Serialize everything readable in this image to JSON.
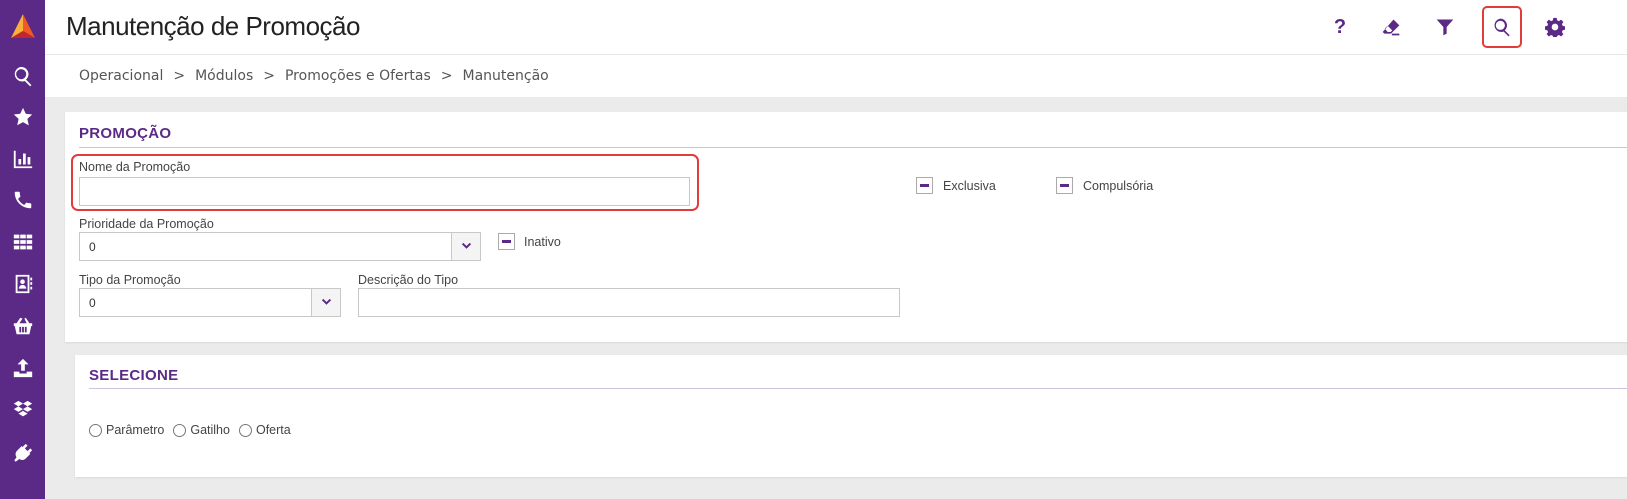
{
  "header": {
    "title": "Manutenção de Promoção",
    "buttons": {
      "help": "?",
      "eraser": "eraser-icon",
      "filter": "filter-icon",
      "search": "search-icon",
      "settings": "gear-icon"
    }
  },
  "sidebar": {
    "items": [
      {
        "icon": "logo-icon"
      },
      {
        "icon": "search-icon"
      },
      {
        "icon": "star-icon"
      },
      {
        "icon": "bar-chart-icon"
      },
      {
        "icon": "phone-icon"
      },
      {
        "icon": "grid-icon"
      },
      {
        "icon": "contact-book-icon"
      },
      {
        "icon": "basket-icon"
      },
      {
        "icon": "upload-icon"
      },
      {
        "icon": "boxes-icon"
      },
      {
        "icon": "plug-icon"
      }
    ]
  },
  "breadcrumb": [
    "Operacional",
    "Módulos",
    "Promoções e Ofertas",
    "Manutenção"
  ],
  "breadcrumb_sep": ">",
  "promocao": {
    "section_title": "PROMOÇÃO",
    "nome_label": "Nome da Promoção",
    "nome_value": "",
    "exclusiva_label": "Exclusiva",
    "compulsoria_label": "Compulsória",
    "prioridade_label": "Prioridade da Promoção",
    "prioridade_value": "0",
    "inativo_label": "Inativo",
    "tipo_label": "Tipo da Promoção",
    "tipo_value": "0",
    "descricao_label": "Descrição do Tipo",
    "descricao_value": ""
  },
  "selecione": {
    "section_title": "SELECIONE",
    "options": [
      "Parâmetro",
      "Gatilho",
      "Oferta"
    ]
  },
  "colors": {
    "brand": "#5b2a86",
    "highlight": "#e23b3b"
  }
}
